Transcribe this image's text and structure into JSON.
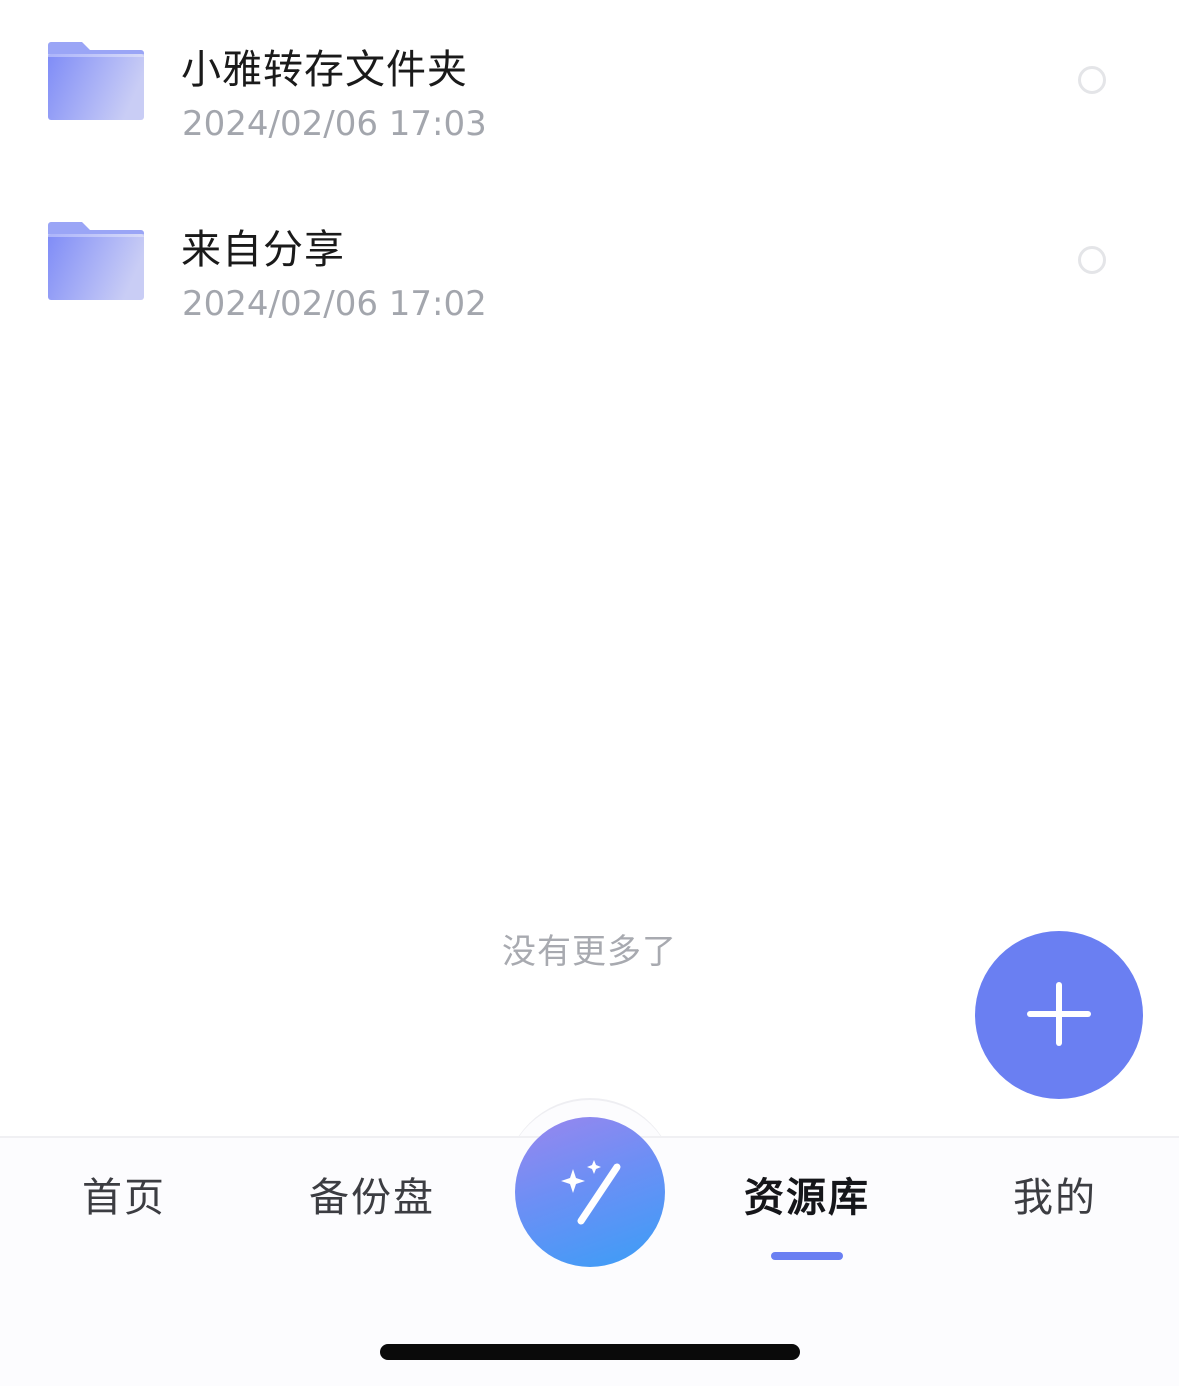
{
  "files": [
    {
      "name": "小雅转存文件夹",
      "date": "2024/02/06 17:03",
      "icon": "folder-icon"
    },
    {
      "name": "来自分享",
      "date": "2024/02/06 17:02",
      "icon": "folder-icon"
    }
  ],
  "list_end_text": "没有更多了",
  "fab": {
    "icon": "plus-icon",
    "color": "#6a7ff2"
  },
  "center_button": {
    "icon": "magic-wand-icon"
  },
  "tabs": [
    {
      "label": "首页",
      "active": false
    },
    {
      "label": "备份盘",
      "active": false
    },
    {
      "label": "资源库",
      "active": true
    },
    {
      "label": "我的",
      "active": false
    }
  ],
  "colors": {
    "accent": "#6a7ff2",
    "folder": "#8b97f5",
    "secondary_text": "#a3a6ad"
  }
}
